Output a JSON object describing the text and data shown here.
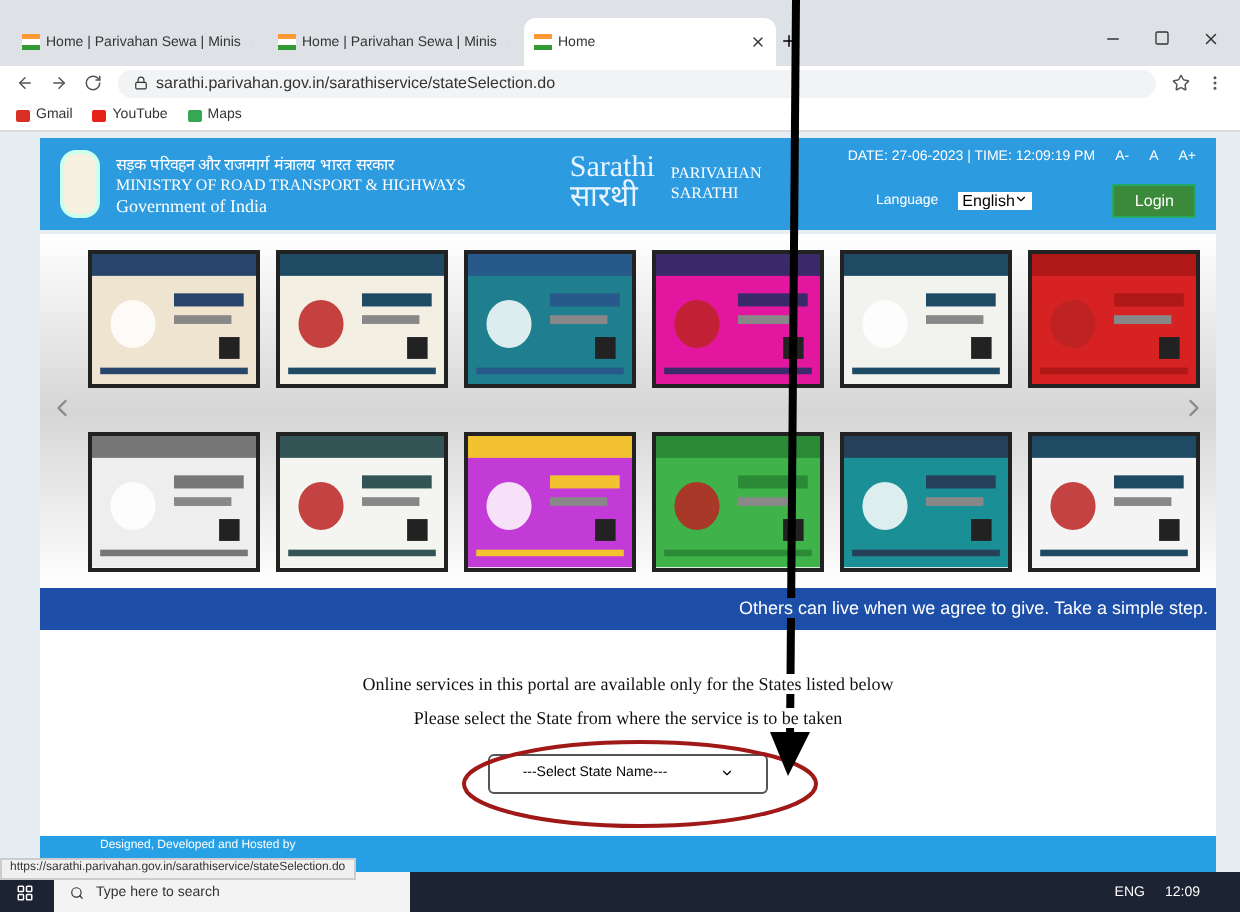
{
  "browser": {
    "tabs": [
      {
        "title": "Home | Parivahan Sewa | Minis",
        "selected": false
      },
      {
        "title": "Home | Parivahan Sewa | Minis",
        "selected": false
      },
      {
        "title": "Home",
        "selected": true
      }
    ],
    "url": "sarathi.parivahan.gov.in/sarathiservice/stateSelection.do",
    "bookmarks": [
      {
        "label": "Gmail",
        "color": "#d93025"
      },
      {
        "label": "YouTube",
        "color": "#e62117"
      },
      {
        "label": "Maps",
        "color": "#34a853"
      }
    ]
  },
  "header": {
    "ministry_hindi": "सड़क परिवहन और राजमार्ग मंत्रालय भारत सरकार",
    "ministry": "MINISTRY OF ROAD TRANSPORT & HIGHWAYS",
    "government": "Government of India",
    "logo_en": "Sarathi",
    "logo_hi": "सारथी",
    "brand_1": "PARIVAHAN",
    "brand_2": "SARATHI",
    "datetime": "DATE: 27-06-2023 | TIME: 12:09:19 PM",
    "font_sizes": [
      "A-",
      "A",
      "A+"
    ],
    "language_label": "Language",
    "language": "English",
    "login": "Login"
  },
  "carousel": {
    "posters": [
      {
        "kind": "picture"
      },
      {
        "kind": "picture"
      },
      {
        "kind": "picture"
      },
      {
        "kind": "picture"
      },
      {
        "kind": "picture"
      },
      {
        "kind": "picture"
      },
      {
        "kind": "picture"
      },
      {
        "kind": "picture"
      },
      {
        "kind": "picture"
      },
      {
        "kind": "picture"
      },
      {
        "kind": "picture"
      },
      {
        "kind": "picture"
      }
    ]
  },
  "marquee": "Others can live when we agree to give. Take a simple step.",
  "notice": [
    "Online services in this portal are available only for the States listed below",
    "Please select the State from where the service is to be taken"
  ],
  "state_select": "---Select State Name---",
  "footer": "Designed, Developed and Hosted by",
  "status_url": "https://sarathi.parivahan.gov.in/sarathiservice/stateSelection.do",
  "taskbar": {
    "search": "Type here to search",
    "lang": "ENG",
    "time": "12:09"
  }
}
